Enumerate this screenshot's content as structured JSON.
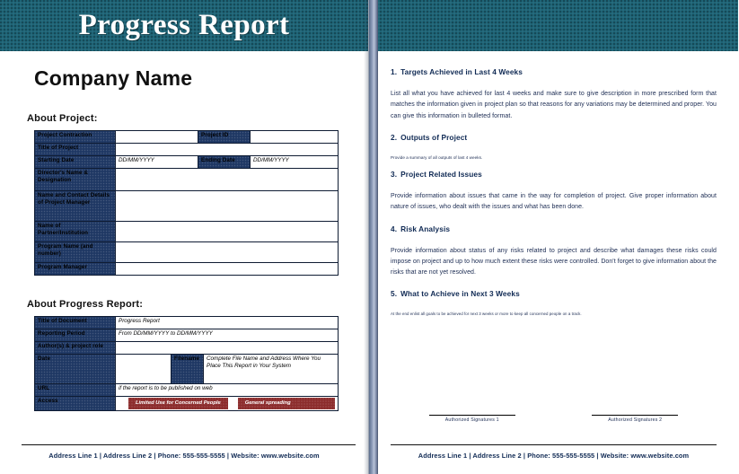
{
  "document": {
    "banner_title": "Progress Report",
    "company_name": "Company Name"
  },
  "colors": {
    "banner": "#1d6375",
    "table_header": "#1f3864",
    "accent_red": "#8c2c2c",
    "heading_blue": "#102a54"
  },
  "left_page": {
    "about_project_label": "About Project:",
    "about_project_table": {
      "rows": [
        {
          "label": "Project Contraction",
          "value": "",
          "label2": "Project ID",
          "value2": ""
        },
        {
          "label": "Title of Project",
          "value": ""
        },
        {
          "label": "Starting Date",
          "value": "DD/MM/YYYY",
          "label2": "Ending Date",
          "value2": "DD/MM/YYYY"
        },
        {
          "label": "Director's Name & Designation",
          "value": ""
        },
        {
          "label": "Name and Contact Details of Project Manager",
          "value": ""
        },
        {
          "label": "Name of Partner/Institution",
          "value": ""
        },
        {
          "label": "Program Name (and number)",
          "value": ""
        },
        {
          "label": "Program Manager",
          "value": ""
        }
      ]
    },
    "about_report_label": "About Progress Report:",
    "about_report_table": {
      "rows": [
        {
          "label": "Title of Document",
          "value": "Progress Report"
        },
        {
          "label": "Reporting Period",
          "value": "From DD/MM/YYYY to DD/MM/YYYY"
        },
        {
          "label": "Author(s) & project role",
          "value": ""
        },
        {
          "label": "Date",
          "value": "",
          "label2": "Filename",
          "value2": "Complete File Name and Address Where You Place This Report in Your System"
        },
        {
          "label": "URL",
          "value": "if the report is to be published on web"
        },
        {
          "label": "Access",
          "chip1": "Limited Use for Concerned People",
          "chip2": "General spreading"
        }
      ]
    },
    "footer": "Address Line 1 | Address Line 2 | Phone: 555-555-5555 | Website: www.website.com"
  },
  "right_page": {
    "sections": [
      {
        "number": "1.",
        "title": "Targets Achieved in Last 4 Weeks",
        "body": "List all what you have achieved for last 4 weeks and make sure to give description in more prescribed form that matches the information given in project plan so that reasons for any variations may be determined and proper. You can give this information in bulleted format.",
        "size": "normal"
      },
      {
        "number": "2.",
        "title": "Outputs of Project",
        "body": "Provide a summary of all outputs of last 4 weeks.",
        "size": "tiny"
      },
      {
        "number": "3.",
        "title": "Project Related Issues",
        "body": "Provide information about issues that came in the way for completion of project. Give proper information about nature of issues, who dealt with the issues and what has been done.",
        "size": "normal"
      },
      {
        "number": "4.",
        "title": "Risk Analysis",
        "body": "Provide information about status of any risks related to project and describe what damages these risks could impose on project and up to how much extent these risks were controlled. Don't forget to give information about the risks that are not yet resolved.",
        "size": "normal"
      },
      {
        "number": "5.",
        "title": "What to Achieve in Next 3 Weeks",
        "body": "At the end enlist all goals to be achieved for next 3 weeks or more to keep all concerned people on a track.",
        "size": "tiny-wide"
      }
    ],
    "signatures": [
      {
        "label": "Authorized Signatures 1"
      },
      {
        "label": "Authorized Signatures 2"
      }
    ],
    "footer": "Address Line 1 | Address Line 2 | Phone: 555-555-5555 | Website: www.website.com"
  }
}
